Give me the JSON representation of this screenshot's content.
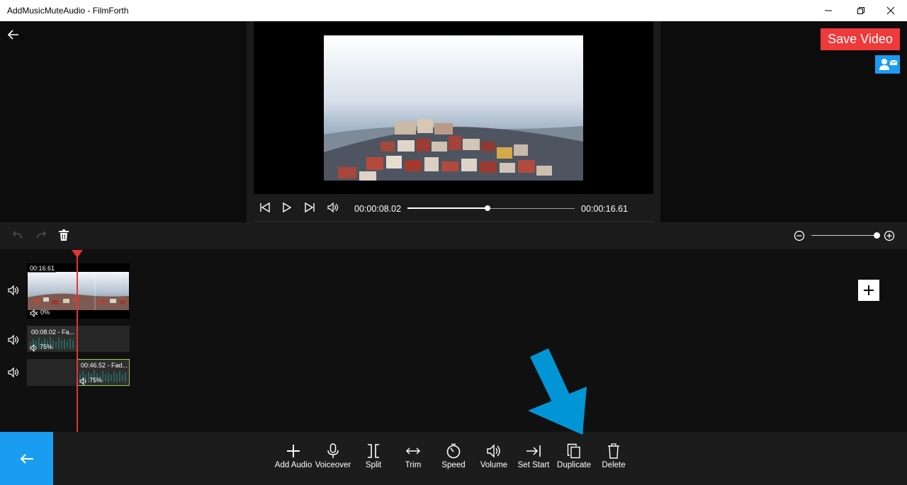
{
  "window": {
    "title": "AddMusicMuteAudio - FilmForth"
  },
  "header": {
    "save_label": "Save Video"
  },
  "player": {
    "current_time": "00:00:08.02",
    "total_time": "00:00:16.61",
    "progress_fraction": 0.48
  },
  "zoom": {
    "level_fraction": 0.98
  },
  "timeline": {
    "video_clip": {
      "duration": "00:16.61",
      "volume": "0%"
    },
    "audio_clip_1": {
      "label": "00:08.02 - Fa...",
      "volume": "75%"
    },
    "audio_clip_2": {
      "label": "00:46.52 - Fad...",
      "volume": "75%"
    }
  },
  "bottom_tools": [
    {
      "label": "Add Audio",
      "icon": "plus-icon"
    },
    {
      "label": "Voiceover",
      "icon": "microphone-icon"
    },
    {
      "label": "Split",
      "icon": "split-icon"
    },
    {
      "label": "Trim",
      "icon": "trim-icon"
    },
    {
      "label": "Speed",
      "icon": "speed-icon"
    },
    {
      "label": "Volume",
      "icon": "volume-icon"
    },
    {
      "label": "Set Start",
      "icon": "set-start-icon"
    },
    {
      "label": "Duplicate",
      "icon": "duplicate-icon"
    },
    {
      "label": "Delete",
      "icon": "delete-icon"
    }
  ],
  "colors": {
    "accent_blue": "#1a9cf0",
    "save_red": "#ef3a3a",
    "playhead_red": "#e23535",
    "selected_clip_border": "#8fd14f",
    "annotation_arrow": "#0096d6"
  }
}
